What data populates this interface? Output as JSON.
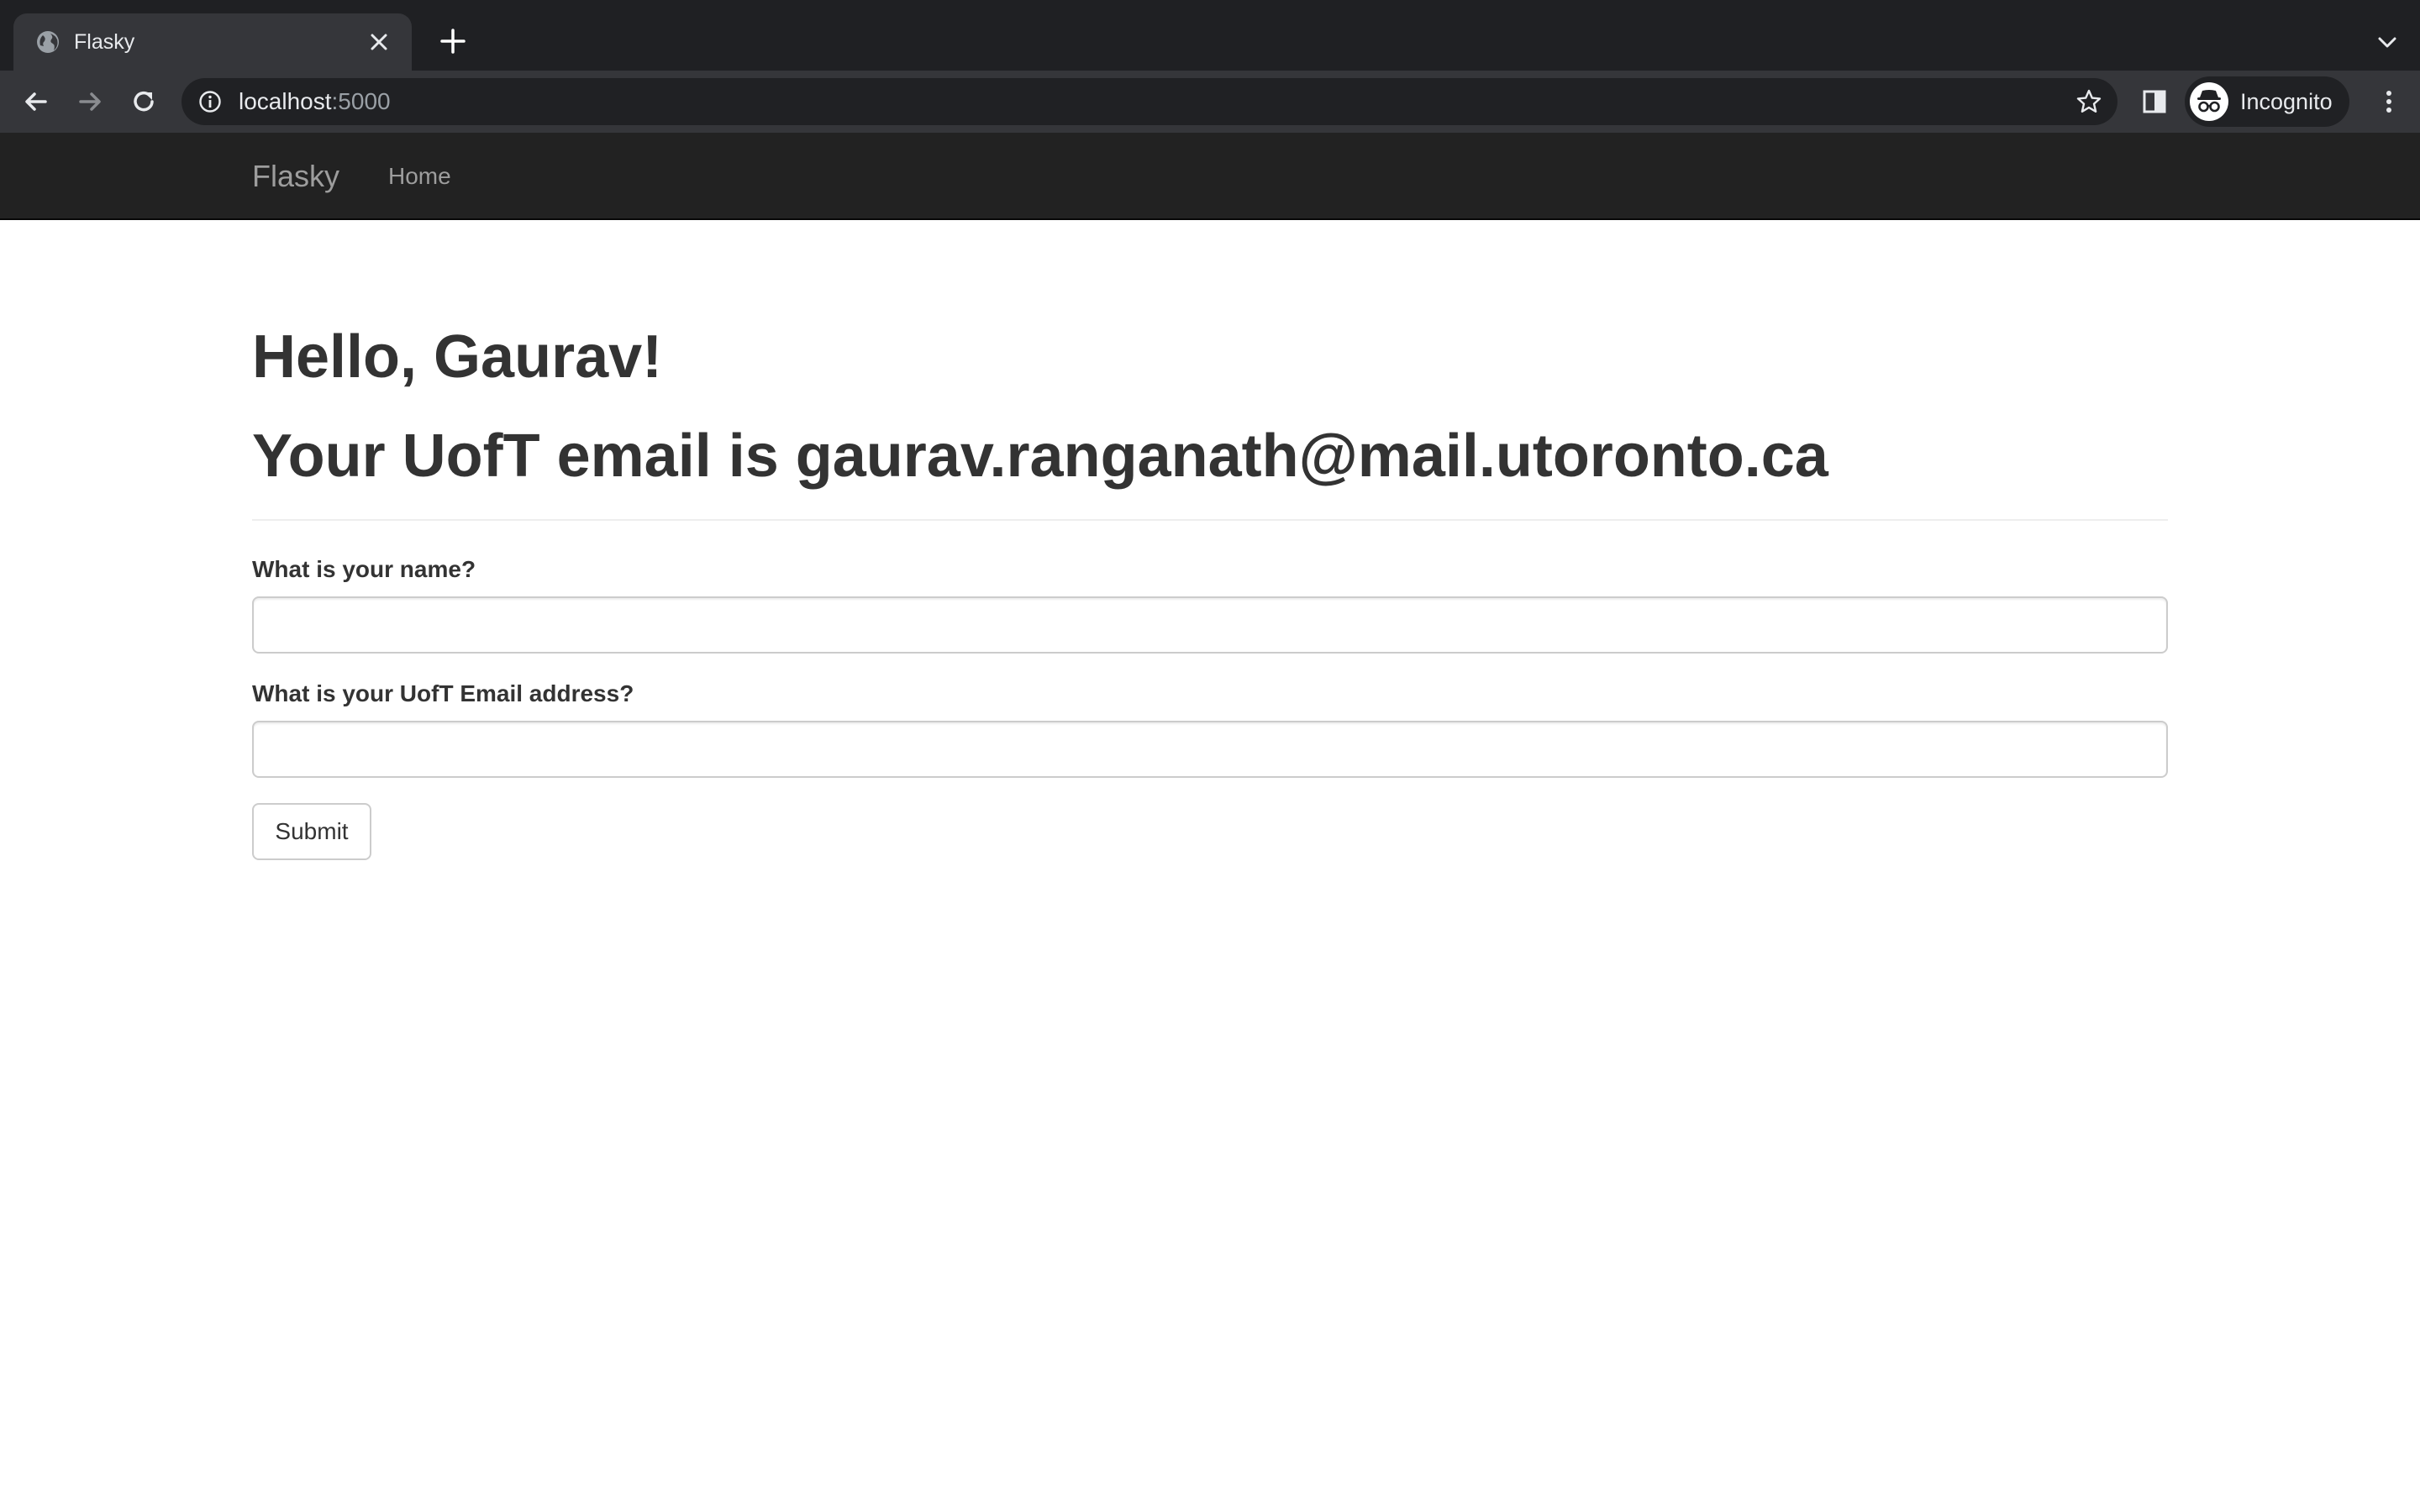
{
  "browser": {
    "tab": {
      "title": "Flasky",
      "favicon": "globe-icon"
    },
    "address_bar": {
      "host": "localhost",
      "port": ":5000"
    },
    "profile": {
      "label": "Incognito",
      "icon": "incognito-icon"
    },
    "colors": {
      "tabstrip": "#1f2023",
      "toolbar": "#35363a",
      "omnibox": "#202124",
      "text": "#e8eaed"
    }
  },
  "navbar": {
    "brand": "Flasky",
    "links": [
      {
        "label": "Home"
      }
    ],
    "colors": {
      "background": "#222222",
      "text": "#9d9d9d"
    }
  },
  "page": {
    "greeting": "Hello, Gaurav!",
    "email_message": "Your UofT email is gaurav.ranganath@mail.utoronto.ca",
    "form": {
      "name_label": "What is your name?",
      "name_value": "",
      "email_label": "What is your UofT Email address?",
      "email_value": "",
      "submit_label": "Submit"
    }
  }
}
